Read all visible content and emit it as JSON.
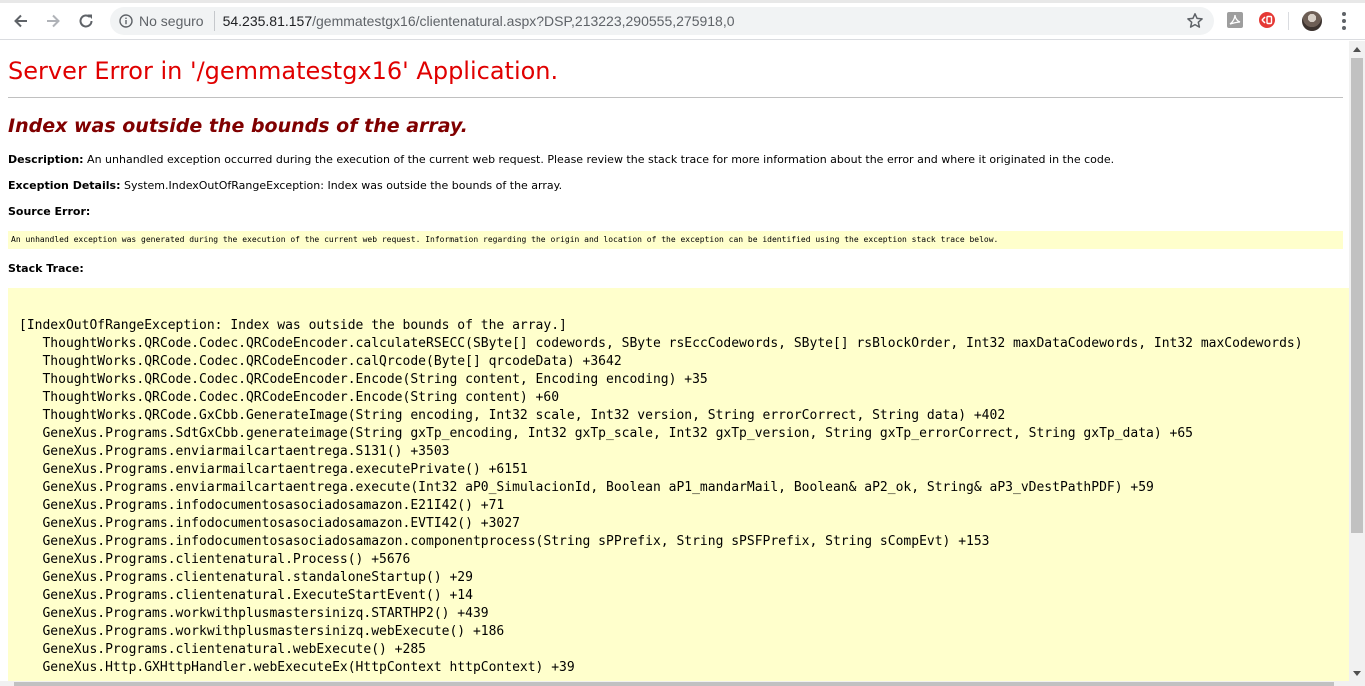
{
  "browser": {
    "security_label": "No seguro",
    "url_host": "54.235.81.157",
    "url_rest": "/gemmatestgx16/clientenatural.aspx?DSP,213223,290555,275918,0"
  },
  "error_page": {
    "title": "Server Error in '/gemmatestgx16' Application.",
    "message": "Index was outside the bounds of the array.",
    "description_label": "Description:",
    "description_text": " An unhandled exception occurred during the execution of the current web request. Please review the stack trace for more information about the error and where it originated in the code.",
    "exception_label": "Exception Details:",
    "exception_text": " System.IndexOutOfRangeException: Index was outside the bounds of the array.",
    "source_error_label": "Source Error:",
    "source_error_text": "An unhandled exception was generated during the execution of the current web request. Information regarding the origin and location of the exception can be identified using the exception stack trace below.",
    "stack_trace_label": "Stack Trace:",
    "stack_trace": [
      "[IndexOutOfRangeException: Index was outside the bounds of the array.]",
      "   ThoughtWorks.QRCode.Codec.QRCodeEncoder.calculateRSECC(SByte[] codewords, SByte rsEccCodewords, SByte[] rsBlockOrder, Int32 maxDataCodewords, Int32 maxCodewords)",
      "   ThoughtWorks.QRCode.Codec.QRCodeEncoder.calQrcode(Byte[] qrcodeData) +3642",
      "   ThoughtWorks.QRCode.Codec.QRCodeEncoder.Encode(String content, Encoding encoding) +35",
      "   ThoughtWorks.QRCode.Codec.QRCodeEncoder.Encode(String content) +60",
      "   ThoughtWorks.QRCode.GxCbb.GenerateImage(String encoding, Int32 scale, Int32 version, String errorCorrect, String data) +402",
      "   GeneXus.Programs.SdtGxCbb.generateimage(String gxTp_encoding, Int32 gxTp_scale, Int32 gxTp_version, String gxTp_errorCorrect, String gxTp_data) +65",
      "   GeneXus.Programs.enviarmailcartaentrega.S131() +3503",
      "   GeneXus.Programs.enviarmailcartaentrega.executePrivate() +6151",
      "   GeneXus.Programs.enviarmailcartaentrega.execute(Int32 aP0_SimulacionId, Boolean aP1_mandarMail, Boolean& aP2_ok, String& aP3_vDestPathPDF) +59",
      "   GeneXus.Programs.infodocumentosasociadosamazon.E21I42() +71",
      "   GeneXus.Programs.infodocumentosasociadosamazon.EVTI42() +3027",
      "   GeneXus.Programs.infodocumentosasociadosamazon.componentprocess(String sPPrefix, String sPSFPrefix, String sCompEvt) +153",
      "   GeneXus.Programs.clientenatural.Process() +5676",
      "   GeneXus.Programs.clientenatural.standaloneStartup() +29",
      "   GeneXus.Programs.clientenatural.ExecuteStartEvent() +14",
      "   GeneXus.Programs.workwithplusmastersinizq.STARTHP2() +439",
      "   GeneXus.Programs.workwithplusmastersinizq.webExecute() +186",
      "   GeneXus.Programs.clientenatural.webExecute() +285",
      "   GeneXus.Http.GXHttpHandler.webExecuteEx(HttpContext httpContext) +39"
    ]
  },
  "colors": {
    "title_red": "#e00000",
    "message_maroon": "#800000",
    "code_background": "#ffffcc"
  },
  "icons": [
    "back-arrow-icon",
    "forward-arrow-icon",
    "reload-icon",
    "info-icon",
    "star-icon",
    "pdf-extension-icon",
    "red-extension-icon",
    "profile-avatar",
    "more-menu-icon"
  ]
}
